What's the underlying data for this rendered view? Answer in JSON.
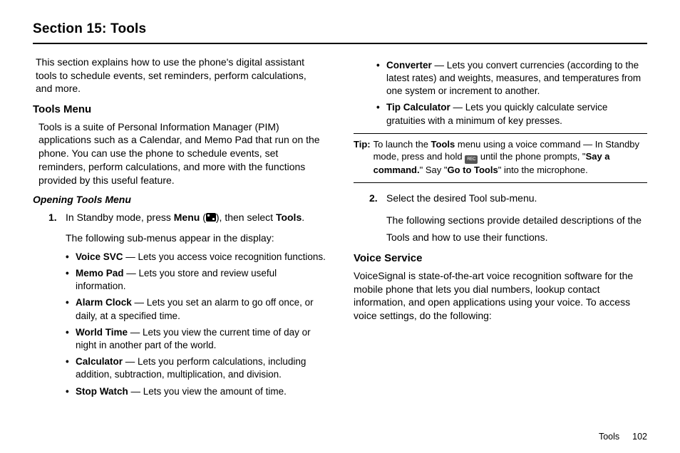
{
  "header": {
    "title": "Section 15: Tools"
  },
  "col1": {
    "intro": "This section explains how to use the phone's digital assistant tools to schedule events, set reminders, perform calculations, and more.",
    "toolsMenu": {
      "heading": "Tools Menu",
      "body": "Tools is a suite of Personal Information Manager (PIM) applications such as a Calendar, and Memo Pad that run on the phone. You can use the phone to schedule events, set reminders, perform calculations, and more with the functions provided by this useful feature.",
      "openingHeading": "Opening Tools Menu",
      "step1_num": "1.",
      "step1_pre": "In Standby mode, press ",
      "step1_menu": "Menu",
      "step1_paren_open": " (",
      "step1_paren_close": "), then select ",
      "step1_tools": "Tools",
      "step1_end": ".",
      "subline": "The following sub-menus appear in the display:",
      "bullets": [
        {
          "b": "Voice SVC",
          "t": " — Lets you access voice recognition functions."
        },
        {
          "b": "Memo Pad",
          "t": " — Lets you store and review useful information."
        },
        {
          "b": "Alarm Clock",
          "t": " — Lets you set an alarm to go off once, or daily, at a specified time."
        },
        {
          "b": "World Time",
          "t": " — Lets you view the current time of day or night in another part of the world."
        },
        {
          "b": "Calculator",
          "t": " — Lets you perform calculations, including addition, subtraction, multiplication, and division."
        },
        {
          "b": "Stop Watch",
          "t": " — Lets you view the amount of time."
        }
      ]
    }
  },
  "col2": {
    "bullets": [
      {
        "b": "Converter",
        "t": " — Lets you convert currencies (according to the latest rates) and weights, measures, and temperatures from one system or increment to another."
      },
      {
        "b": "Tip Calculator",
        "t": " — Lets you quickly calculate service gratuities with a minimum of key presses."
      }
    ],
    "tip": {
      "label": "Tip:",
      "pre": " To launch the ",
      "b1": "Tools",
      "mid1": " menu using a voice command — In Standby mode, press and hold ",
      "mid2": " until the phone prompts, \"",
      "b2": "Say a command.",
      "mid3": "\" Say \"",
      "b3": "Go to Tools",
      "end": "\" into the microphone."
    },
    "step2_num": "2.",
    "step2_text": "Select the desired Tool sub-menu.",
    "step2_follow": "The following sections provide detailed descriptions of the Tools and how to use their functions.",
    "voiceService": {
      "heading": "Voice Service",
      "body": "VoiceSignal is state-of-the-art voice recognition software for the mobile phone that lets you dial numbers, lookup contact information, and open applications using your voice. To access voice settings, do the following:"
    }
  },
  "footer": {
    "section": "Tools",
    "page": "102"
  }
}
